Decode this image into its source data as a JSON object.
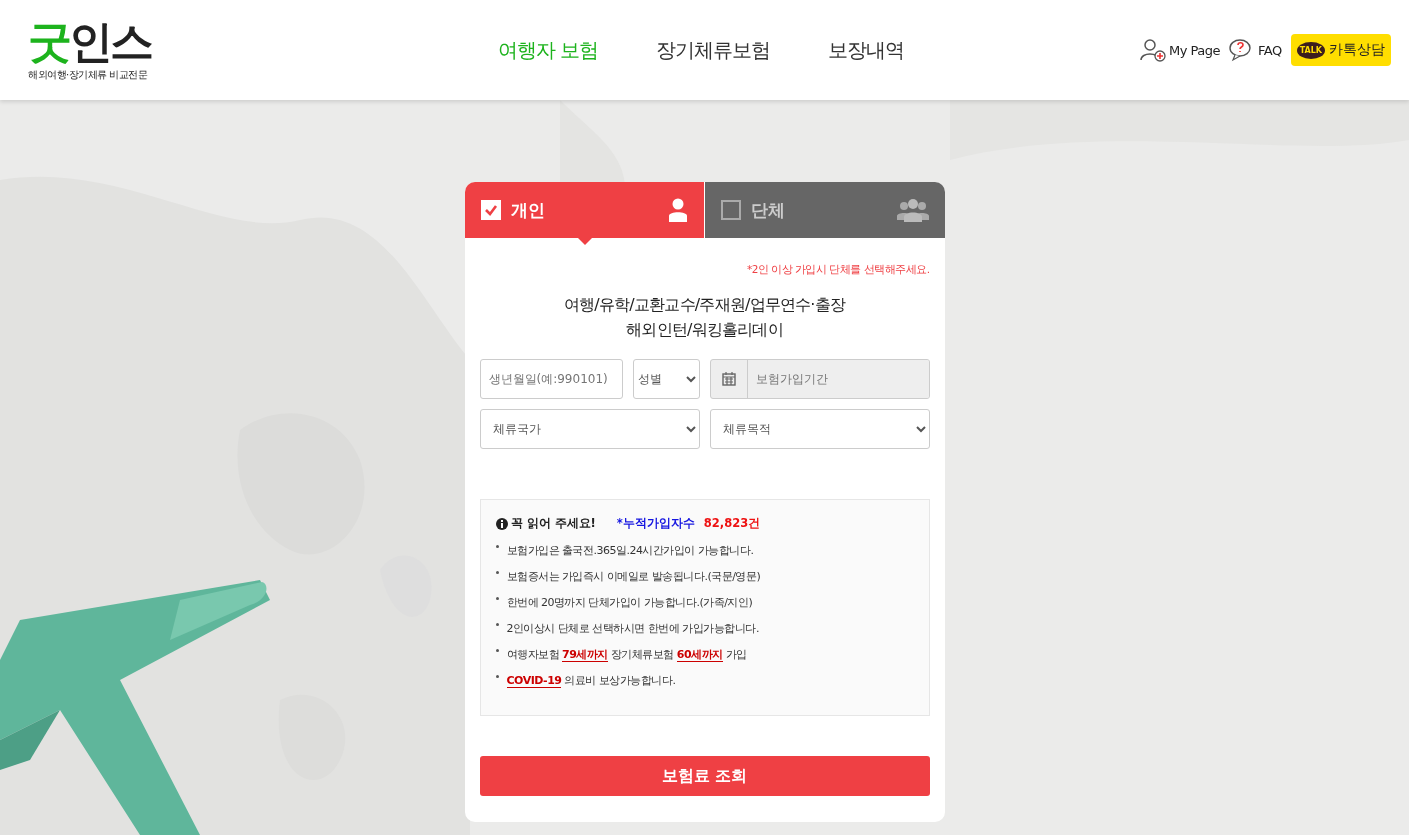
{
  "logo": {
    "accent": "굿",
    "rest": "인스",
    "tagline": "해외여행·장기체류 비교전문"
  },
  "nav": [
    {
      "label": "여행자 보험",
      "selected": true
    },
    {
      "label": "장기체류보험",
      "selected": false
    },
    {
      "label": "보장내역",
      "selected": false
    }
  ],
  "util": {
    "mypage": "My Page",
    "faq": "FAQ",
    "talk_badge": "TALK",
    "talk": "카톡상담"
  },
  "background": {
    "kind": "picture"
  },
  "tabs": [
    {
      "label": "개인",
      "selected": true,
      "kind": "single"
    },
    {
      "label": "단체",
      "selected": false,
      "kind": "group"
    }
  ],
  "group_note": "*2인 이상 가입시 단체를 선택해주세요.",
  "headline": [
    "여행/유학/교환교수/주재원/업무연수·출장",
    "해외인턴/워킹홀리데이"
  ],
  "form": {
    "birth_placeholder": "생년월일(예:990101)",
    "gender": "성별",
    "period_placeholder": "보험가입기간",
    "country": "체류국가",
    "purpose": "체류목적"
  },
  "notice": {
    "title": "꼭 읽어 주세요!",
    "count_label": "*누적가입자수",
    "count": "82,823건",
    "items": [
      "보험가입은 출국전.365일.24시간가입이 가능합니다.",
      "보험증서는 가입즉시 이메일로 발송됩니다.(국문/영문)",
      "한번에 20명까지 단체가입이 가능합니다.(가족/지인)",
      "2인이상시 단체로 선택하시면 한번에 가입가능합니다.",
      "여행자보험 **79세까지** 장기체류보험 **60세까지** 가입",
      "**COVID-19** 의료비 보상가능합니다."
    ]
  },
  "submit": "보험료 조회"
}
